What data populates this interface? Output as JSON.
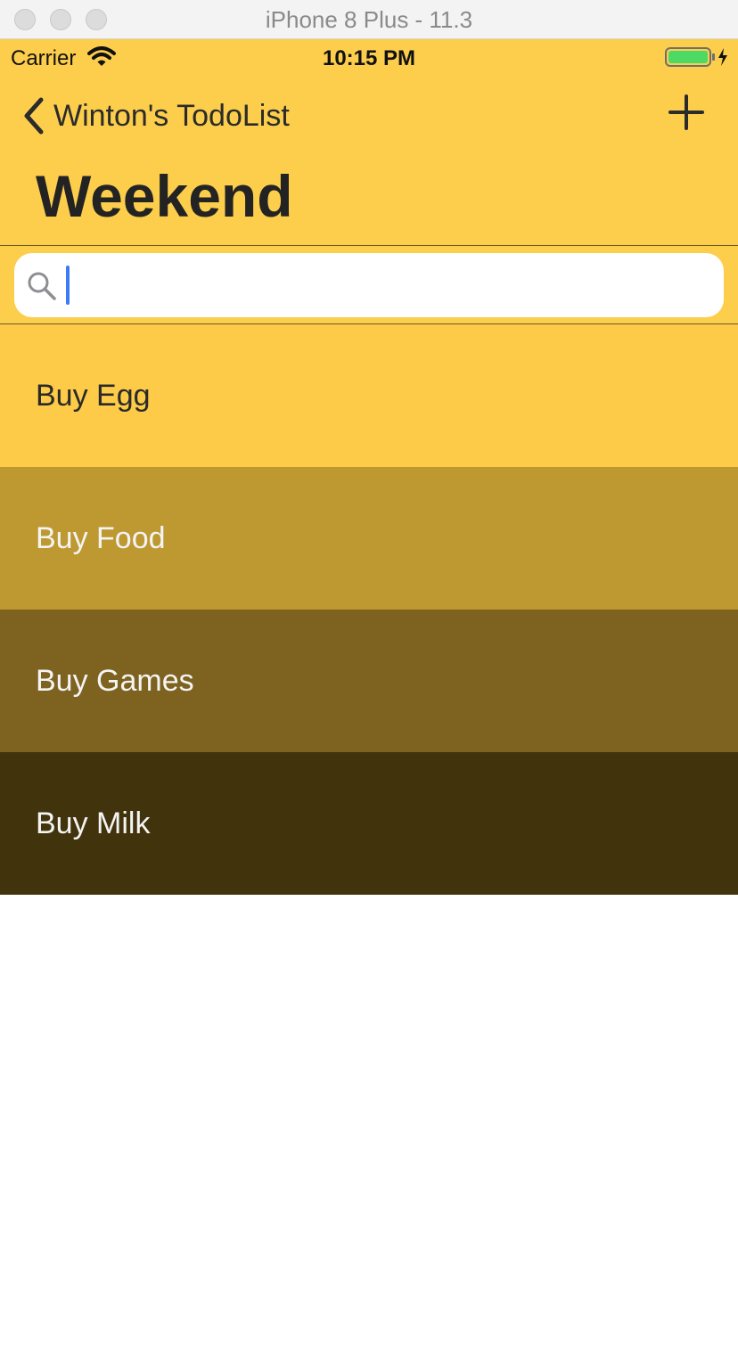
{
  "window": {
    "title": "iPhone 8 Plus - 11.3"
  },
  "status_bar": {
    "carrier": "Carrier",
    "time": "10:15 PM",
    "wifi_icon": "wifi-icon",
    "battery_icon": "battery-charging-icon"
  },
  "nav": {
    "back_label": "Winton's TodoList",
    "back_icon": "chevron-left-icon",
    "add_icon": "plus-icon",
    "title": "Weekend"
  },
  "search": {
    "value": "",
    "placeholder": "",
    "icon": "search-icon"
  },
  "colors": {
    "accent": "#fdce4c",
    "caret": "#3b7bf6"
  },
  "items": [
    {
      "label": "Buy Egg",
      "bg": "#fdcb48",
      "fg": "#2a2a2a"
    },
    {
      "label": "Buy Food",
      "bg": "#be9932",
      "fg": "#f4f4f4"
    },
    {
      "label": "Buy Games",
      "bg": "#7e6320",
      "fg": "#f4f4f4"
    },
    {
      "label": "Buy Milk",
      "bg": "#41330c",
      "fg": "#f4f4f4"
    }
  ]
}
